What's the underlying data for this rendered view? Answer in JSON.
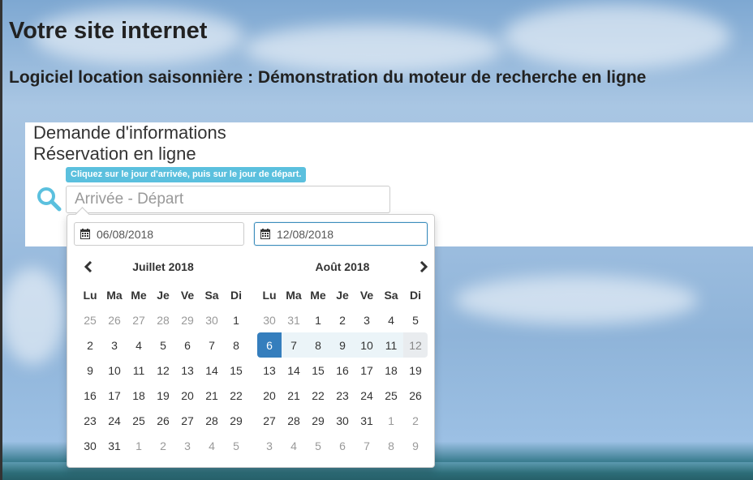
{
  "site": {
    "title": "Votre site internet",
    "subtitle": "Logiciel location saisonnière : Démonstration du moteur de recherche en ligne"
  },
  "menu": {
    "items": [
      {
        "label": "Demande d'informations"
      },
      {
        "label": "Réservation en ligne"
      }
    ]
  },
  "search": {
    "hint": "Cliquez sur le jour d'arrivée, puis sur le jour de départ.",
    "placeholder": "Arrivée - Départ",
    "icon": "search-icon",
    "icon_color": "#5bc0de"
  },
  "datepicker": {
    "start_date": "06/08/2018",
    "end_date": "12/08/2018",
    "selection_color": "#357ebd",
    "range_color": "#ebf4f8",
    "weekdays": [
      "Lu",
      "Ma",
      "Me",
      "Je",
      "Ve",
      "Sa",
      "Di"
    ],
    "months": [
      {
        "name": "Juillet 2018",
        "weeks": [
          [
            {
              "d": "25",
              "off": true
            },
            {
              "d": "26",
              "off": true
            },
            {
              "d": "27",
              "off": true
            },
            {
              "d": "28",
              "off": true
            },
            {
              "d": "29",
              "off": true
            },
            {
              "d": "30",
              "off": true
            },
            {
              "d": "1"
            }
          ],
          [
            {
              "d": "2"
            },
            {
              "d": "3"
            },
            {
              "d": "4"
            },
            {
              "d": "5"
            },
            {
              "d": "6"
            },
            {
              "d": "7"
            },
            {
              "d": "8"
            }
          ],
          [
            {
              "d": "9"
            },
            {
              "d": "10"
            },
            {
              "d": "11"
            },
            {
              "d": "12"
            },
            {
              "d": "13"
            },
            {
              "d": "14"
            },
            {
              "d": "15"
            }
          ],
          [
            {
              "d": "16"
            },
            {
              "d": "17"
            },
            {
              "d": "18"
            },
            {
              "d": "19"
            },
            {
              "d": "20"
            },
            {
              "d": "21"
            },
            {
              "d": "22"
            }
          ],
          [
            {
              "d": "23"
            },
            {
              "d": "24"
            },
            {
              "d": "25"
            },
            {
              "d": "26"
            },
            {
              "d": "27"
            },
            {
              "d": "28"
            },
            {
              "d": "29"
            }
          ],
          [
            {
              "d": "30"
            },
            {
              "d": "31"
            },
            {
              "d": "1",
              "off": true
            },
            {
              "d": "2",
              "off": true
            },
            {
              "d": "3",
              "off": true
            },
            {
              "d": "4",
              "off": true
            },
            {
              "d": "5",
              "off": true
            }
          ]
        ]
      },
      {
        "name": "Août 2018",
        "weeks": [
          [
            {
              "d": "30",
              "off": true
            },
            {
              "d": "31",
              "off": true
            },
            {
              "d": "1"
            },
            {
              "d": "2"
            },
            {
              "d": "3"
            },
            {
              "d": "4"
            },
            {
              "d": "5"
            }
          ],
          [
            {
              "d": "6",
              "state": "start"
            },
            {
              "d": "7",
              "state": "range"
            },
            {
              "d": "8",
              "state": "range"
            },
            {
              "d": "9",
              "state": "range"
            },
            {
              "d": "10",
              "state": "range"
            },
            {
              "d": "11",
              "state": "range"
            },
            {
              "d": "12",
              "state": "end"
            }
          ],
          [
            {
              "d": "13"
            },
            {
              "d": "14"
            },
            {
              "d": "15"
            },
            {
              "d": "16"
            },
            {
              "d": "17"
            },
            {
              "d": "18"
            },
            {
              "d": "19"
            }
          ],
          [
            {
              "d": "20"
            },
            {
              "d": "21"
            },
            {
              "d": "22"
            },
            {
              "d": "23"
            },
            {
              "d": "24"
            },
            {
              "d": "25"
            },
            {
              "d": "26"
            }
          ],
          [
            {
              "d": "27"
            },
            {
              "d": "28"
            },
            {
              "d": "29"
            },
            {
              "d": "30"
            },
            {
              "d": "31"
            },
            {
              "d": "1",
              "off": true
            },
            {
              "d": "2",
              "off": true
            }
          ],
          [
            {
              "d": "3",
              "off": true
            },
            {
              "d": "4",
              "off": true
            },
            {
              "d": "5",
              "off": true
            },
            {
              "d": "6",
              "off": true
            },
            {
              "d": "7",
              "off": true
            },
            {
              "d": "8",
              "off": true
            },
            {
              "d": "9",
              "off": true
            }
          ]
        ]
      }
    ]
  }
}
